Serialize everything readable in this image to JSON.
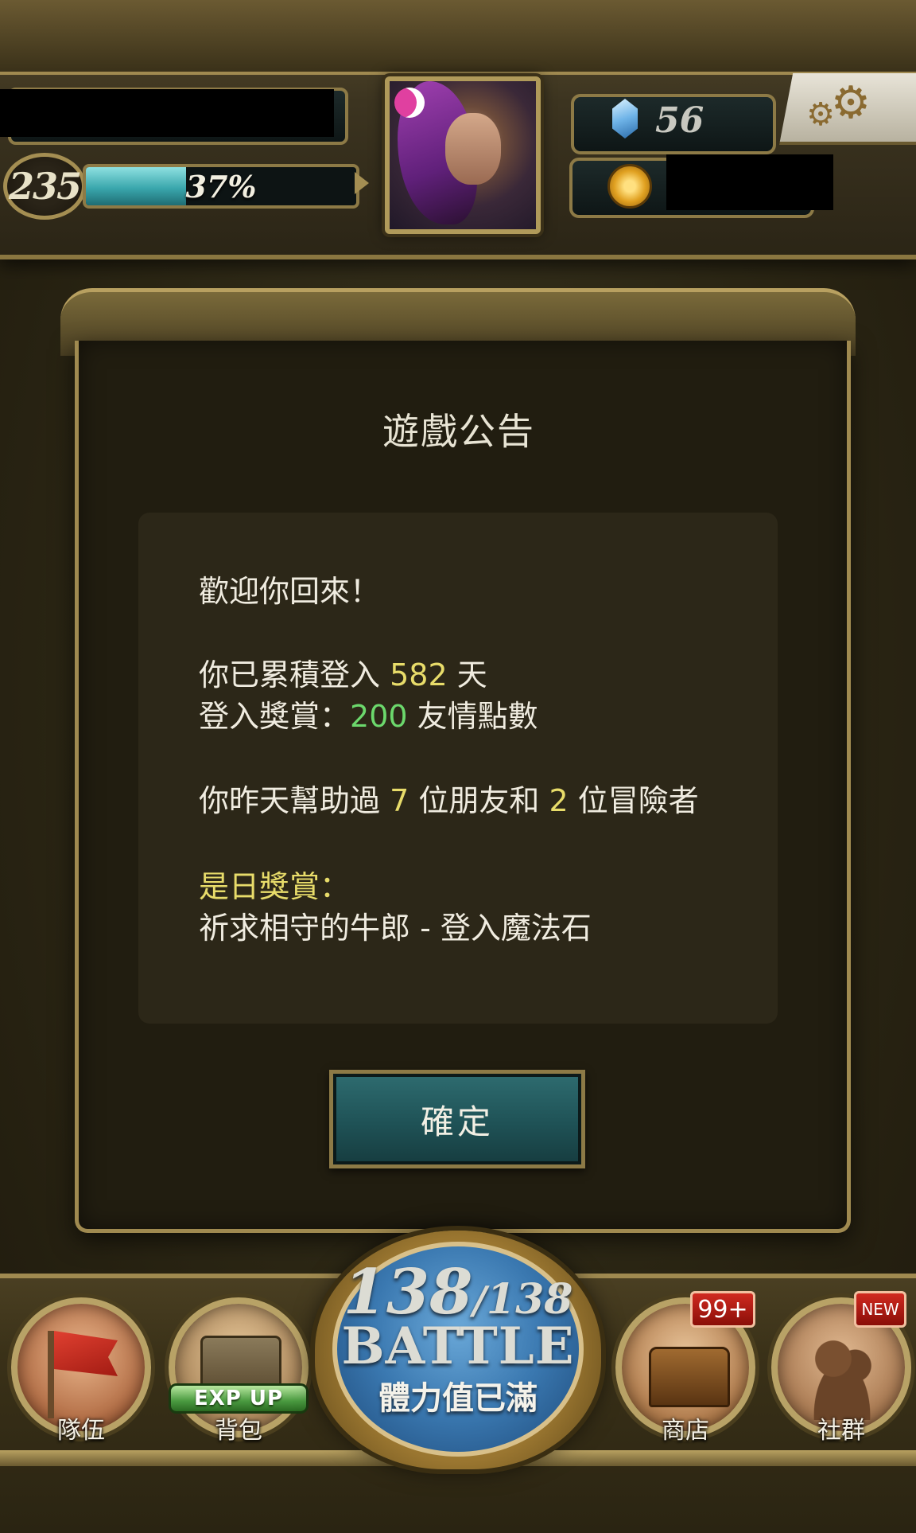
{
  "hud": {
    "level": "235",
    "exp_percent": "37%",
    "exp_fraction": 0.37,
    "gems": "56"
  },
  "dialog": {
    "title": "遊戲公告",
    "welcome": "歡迎你回來！",
    "login_prefix": "你已累積登入 ",
    "login_days": "582",
    "login_suffix": " 天",
    "reward_prefix": "登入獎賞：",
    "reward_amount": "200",
    "reward_suffix": " 友情點數",
    "help_prefix": "你昨天幫助過 ",
    "help_friends": "7",
    "help_mid": " 位朋友和 ",
    "help_adventurers": "2",
    "help_suffix": " 位冒險者",
    "daily_reward_label": "是日獎賞：",
    "daily_reward_item": "祈求相守的牛郎 - 登入魔法石",
    "confirm_label": "確定"
  },
  "bottom_nav": {
    "team_label": "隊伍",
    "bag_label": "背包",
    "bag_badge": "EXP UP",
    "shop_label": "商店",
    "shop_badge": "99+",
    "social_label": "社群",
    "social_badge": "NEW"
  },
  "battle": {
    "stamina_current": "138",
    "stamina_slash": "/",
    "stamina_max": "138",
    "label": "BATTLE",
    "status": "體力值已滿"
  },
  "icons": {
    "gem": "gem-icon",
    "coin": "coin-icon",
    "settings": "gear-icon",
    "team": "flag-icon",
    "bag": "bag-icon",
    "shop": "chest-icon",
    "social": "people-icon"
  },
  "colors": {
    "highlight_yellow": "#e8dc6a",
    "highlight_green": "#6cd86c",
    "exp_teal": "#3aa7ad",
    "button_teal": "#1f5256",
    "frame_gold": "#a08a50"
  }
}
